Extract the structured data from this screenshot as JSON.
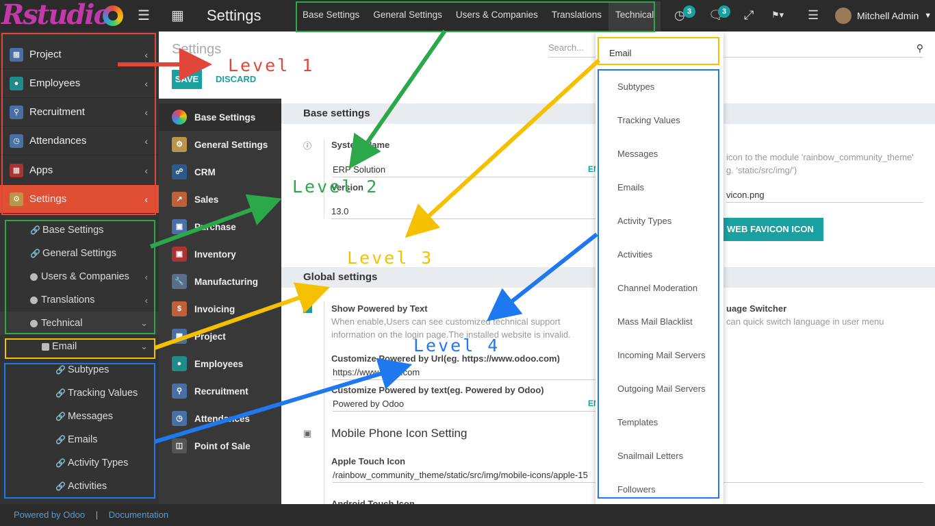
{
  "topbar": {
    "logo_text": "Rstudio",
    "app_title": "Settings",
    "menu": [
      "Base Settings",
      "General Settings",
      "Users & Companies",
      "Translations",
      "Technical"
    ],
    "activity_count": "3",
    "message_count": "3",
    "user_name": "Mitchell Admin"
  },
  "sidebar": {
    "items": [
      {
        "label": "Project",
        "icon": "puzzle-icon",
        "color": "#4a6fa5"
      },
      {
        "label": "Employees",
        "icon": "people-icon",
        "color": "#1f8b8b"
      },
      {
        "label": "Recruitment",
        "icon": "search-icon",
        "color": "#4a6fa5"
      },
      {
        "label": "Attendances",
        "icon": "user-clock-icon",
        "color": "#4a6fa5"
      },
      {
        "label": "Apps",
        "icon": "puzzle-icon",
        "color": "#a33"
      },
      {
        "label": "Settings",
        "icon": "gear-icon",
        "color": "#b8964a"
      }
    ],
    "sub_items": [
      "Base Settings",
      "General Settings",
      "Users & Companies",
      "Translations",
      "Technical"
    ],
    "email": "Email",
    "email_children": [
      "Subtypes",
      "Tracking Values",
      "Messages",
      "Emails",
      "Activity Types",
      "Activities"
    ]
  },
  "control_panel": {
    "title": "Settings",
    "save": "SAVE",
    "discard": "DISCARD",
    "search_placeholder": "Search..."
  },
  "settings_apps": [
    {
      "label": "Base Settings",
      "color": "#222"
    },
    {
      "label": "General Settings",
      "color": "#b8964a"
    },
    {
      "label": "CRM",
      "color": "#2e5a8a"
    },
    {
      "label": "Sales",
      "color": "#c0603a"
    },
    {
      "label": "Purchase",
      "color": "#4a6fa5"
    },
    {
      "label": "Inventory",
      "color": "#a33"
    },
    {
      "label": "Manufacturing",
      "color": "#5a6d8a"
    },
    {
      "label": "Invoicing",
      "color": "#c0603a"
    },
    {
      "label": "Project",
      "color": "#4a6fa5"
    },
    {
      "label": "Employees",
      "color": "#1f8b8b"
    },
    {
      "label": "Recruitment",
      "color": "#4a6fa5"
    },
    {
      "label": "Attendances",
      "color": "#4a6fa5"
    },
    {
      "label": "Point of Sale",
      "color": "#555"
    }
  ],
  "content": {
    "base_section": "Base settings",
    "system_name_label": "System Name",
    "system_name_value": "ERP Solution",
    "version_label": "Version",
    "version_value": "13.0",
    "lang_tag": "EN",
    "favicon_help_1": "icon to the module 'rainbow_community_theme'",
    "favicon_help_2": "g. 'static/src/img/')",
    "favicon_value": "vicon.png",
    "favicon_button": "WEB FAVICON ICON",
    "global_section": "Global settings",
    "show_powered_label": "Show Powered by Text",
    "show_powered_help_1": "When enable,Users can see customized technical support",
    "show_powered_help_2": "information on the login page.The installed website is invalid.",
    "lang_switcher_label": "uage Switcher",
    "lang_switcher_help": "can quick switch language in user menu",
    "url_label": "Customize Powered by Url(eg. https://www.odoo.com)",
    "url_value": "https://www.odoo.com",
    "text_label": "Customize Powered by text(eg. Powered by Odoo)",
    "text_value": "Powered by Odoo",
    "mobile_heading": "Mobile Phone Icon Setting",
    "apple_label": "Apple Touch Icon",
    "apple_value": "/rainbow_community_theme/static/src/img/mobile-icons/apple-15",
    "android_label": "Android Touch Icon"
  },
  "dropdown": {
    "header": "Email",
    "items": [
      "Subtypes",
      "Tracking Values",
      "Messages",
      "Emails",
      "Activity Types",
      "Activities",
      "Channel Moderation",
      "Mass Mail Blacklist",
      "Incoming Mail Servers",
      "Outgoing Mail Servers",
      "Templates",
      "Snailmail Letters",
      "Followers"
    ]
  },
  "footer": {
    "powered": "Powered by Odoo",
    "separator": "|",
    "documentation": "Documentation"
  },
  "annotations": {
    "level1": "Level 1",
    "level2": "Level 2",
    "level3": "Level 3",
    "level4": "Level 4",
    "colors": {
      "red": "#e0473a",
      "green": "#2aa84a",
      "yellow": "#f5c000",
      "blue": "#1e78f0"
    }
  }
}
